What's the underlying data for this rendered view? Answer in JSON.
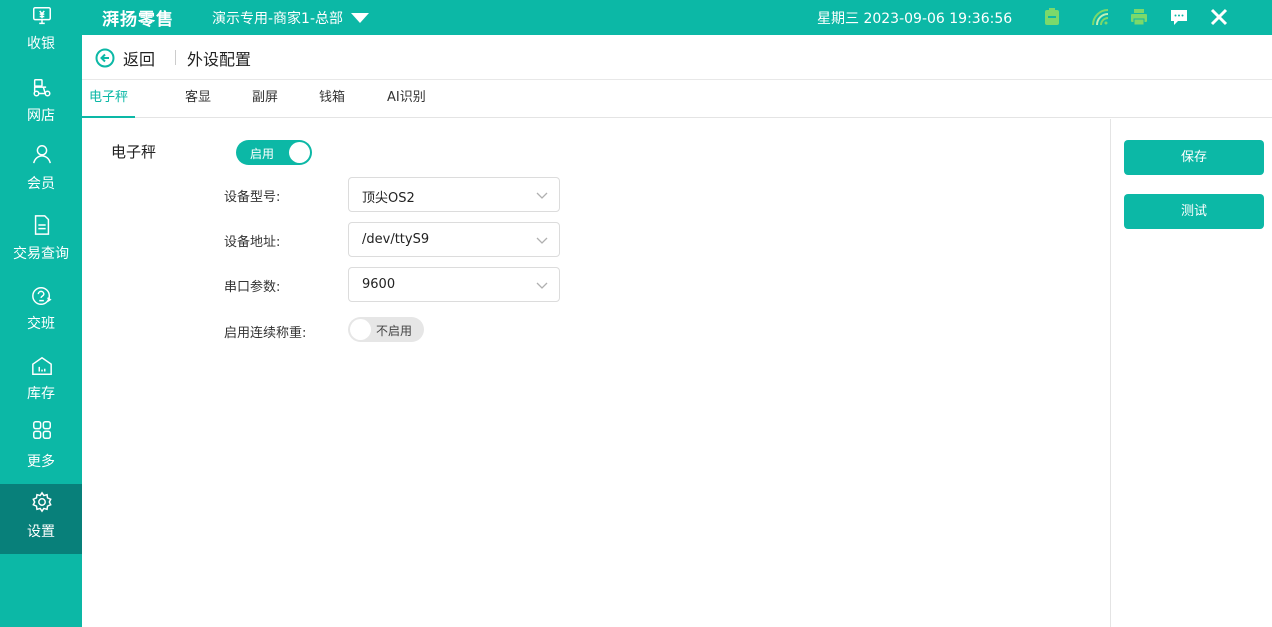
{
  "topbar": {
    "brand": "湃扬零售",
    "store_name": "演示专用-商家1-总部",
    "datetime": "星期三 2023-09-06 19:36:56",
    "icons": [
      "battery-icon",
      "wifi-icon",
      "printer-icon",
      "message-icon",
      "close-icon"
    ]
  },
  "sidebar": {
    "items": [
      {
        "label": "收银",
        "icon": "cashier-icon"
      },
      {
        "label": "网店",
        "icon": "scooter-icon"
      },
      {
        "label": "会员",
        "icon": "member-icon"
      },
      {
        "label": "交易查询",
        "icon": "document-icon"
      },
      {
        "label": "交班",
        "icon": "handover-icon"
      },
      {
        "label": "库存",
        "icon": "warehouse-icon"
      },
      {
        "label": "更多",
        "icon": "grid-icon"
      },
      {
        "label": "设置",
        "icon": "gear-icon"
      }
    ],
    "active_index": 7
  },
  "header": {
    "back_label": "返回",
    "title": "外设配置"
  },
  "tabs": [
    {
      "label": "电子秤"
    },
    {
      "label": "客显"
    },
    {
      "label": "副屏"
    },
    {
      "label": "钱箱"
    },
    {
      "label": "AI识别"
    }
  ],
  "active_tab": 0,
  "scale": {
    "section_label": "电子秤",
    "enable_toggle": {
      "label": "启用",
      "on": true
    },
    "fields": [
      {
        "label": "设备型号:",
        "value": "顶尖OS2"
      },
      {
        "label": "设备地址:",
        "value": "/dev/ttyS9"
      },
      {
        "label": "串口参数:",
        "value": "9600"
      }
    ],
    "continuous_weighing": {
      "label": "启用连续称重:",
      "toggle_label": "不启用",
      "on": false
    }
  },
  "actions": {
    "save_label": "保存",
    "test_label": "测试"
  },
  "colors": {
    "accent": "#0cb8a6",
    "sidebar_active": "#08807a",
    "battery": "#7bd96b"
  }
}
